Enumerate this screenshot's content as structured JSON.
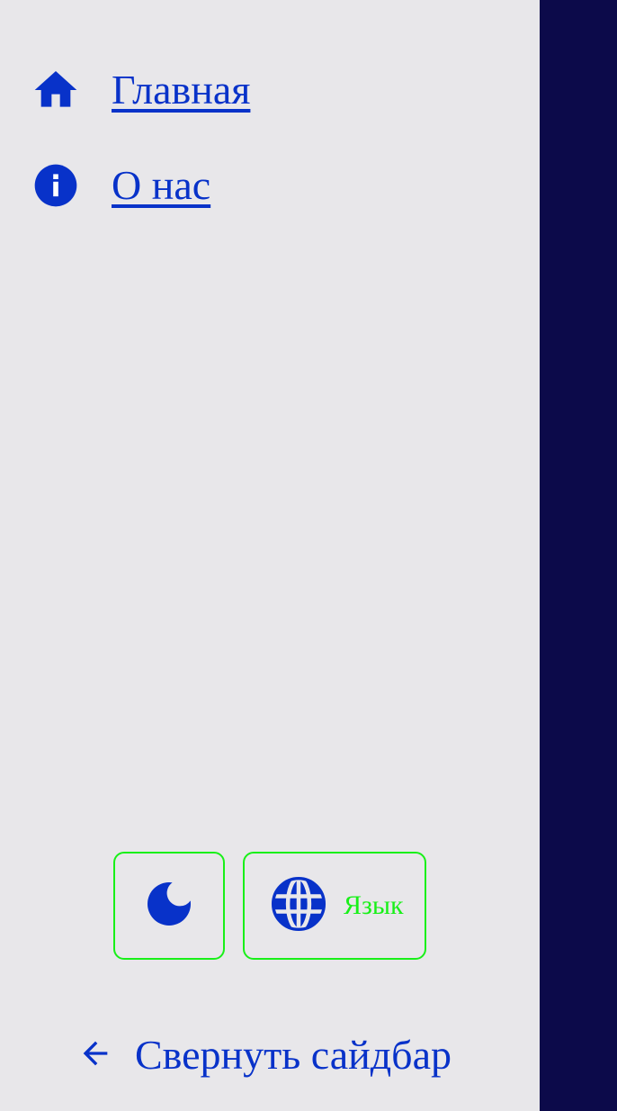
{
  "sidebar": {
    "nav": [
      {
        "label": "Главная",
        "icon": "home-icon"
      },
      {
        "label": "О нас",
        "icon": "info-icon"
      }
    ],
    "theme_toggle_icon": "moon-icon",
    "language_button": {
      "label": "Язык",
      "icon": "globe-icon"
    },
    "collapse": {
      "label": "Свернуть сайдбар",
      "icon": "arrow-left-icon"
    }
  },
  "colors": {
    "sidebar_bg": "#e8e7ea",
    "main_bg": "#0c0a4a",
    "accent": "#0832c9",
    "button_border": "#18f018"
  }
}
